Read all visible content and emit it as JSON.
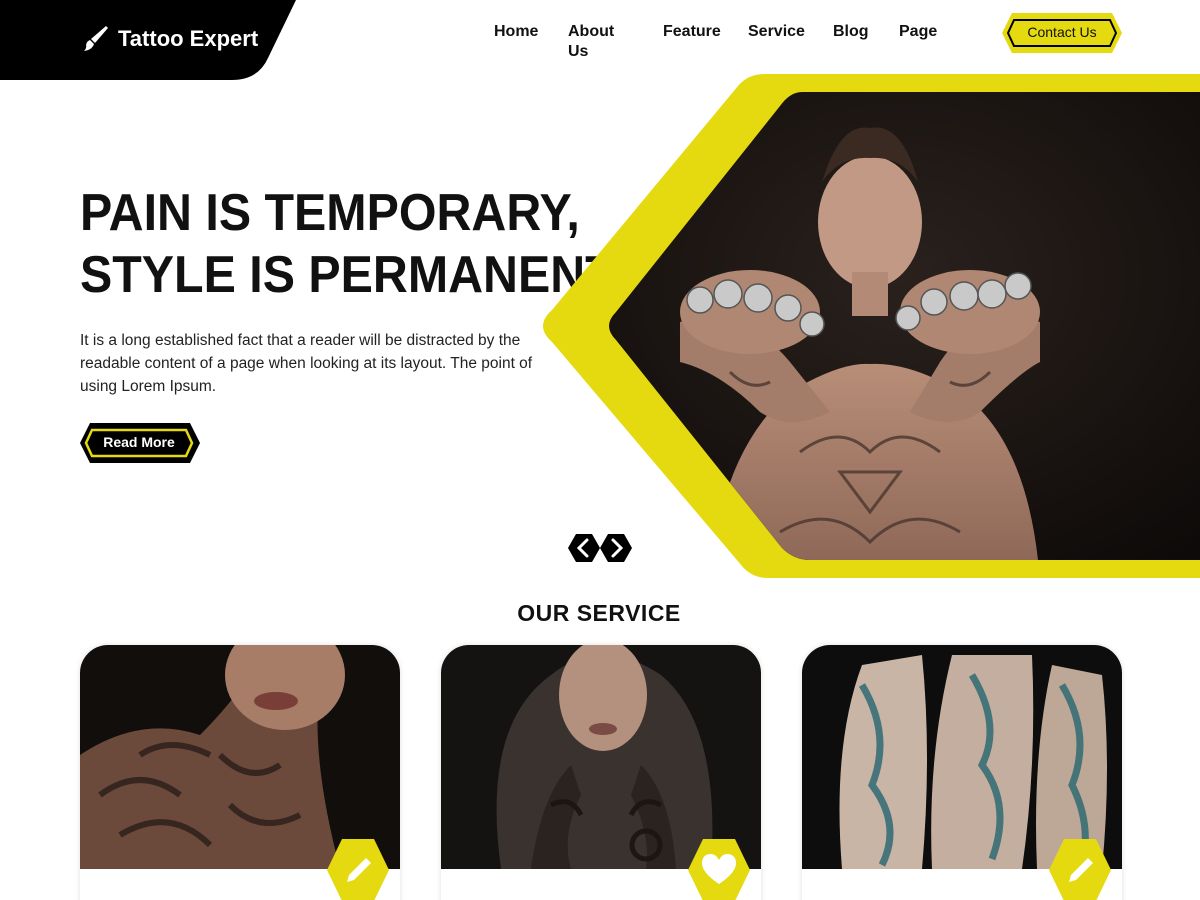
{
  "brand": {
    "name": "Tattoo Expert",
    "icon": "brush-icon"
  },
  "nav": {
    "items": [
      {
        "label": "Home"
      },
      {
        "label": "About Us"
      },
      {
        "label": "Feature"
      },
      {
        "label": "Service"
      },
      {
        "label": "Blog"
      },
      {
        "label": "Page"
      }
    ],
    "contact_label": "Contact Us"
  },
  "hero": {
    "title_line1": "PAIN IS TEMPORARY,",
    "title_line2": "STYLE IS PERMANENT",
    "text": "It is a long established fact that a reader will be distracted by the readable content of a page when looking at its layout. The point of using Lorem Ipsum.",
    "button_label": "Read More",
    "image_subject": "tattooed man with skull rings, fists forward",
    "slider": {
      "prev_icon": "chevron-left-icon",
      "next_icon": "chevron-right-icon"
    }
  },
  "services": {
    "title": "OUR SERVICE",
    "cards": [
      {
        "image_subject": "tattooed neck and shoulder",
        "badge_icon": "pencil-icon"
      },
      {
        "image_subject": "tattooed woman with hands on face",
        "badge_icon": "heart-icon"
      },
      {
        "image_subject": "tattooed legs",
        "badge_icon": "pencil-icon"
      }
    ]
  },
  "colors": {
    "accent": "#e5d90f",
    "dark": "#000000",
    "text": "#111111",
    "background": "#ffffff"
  }
}
